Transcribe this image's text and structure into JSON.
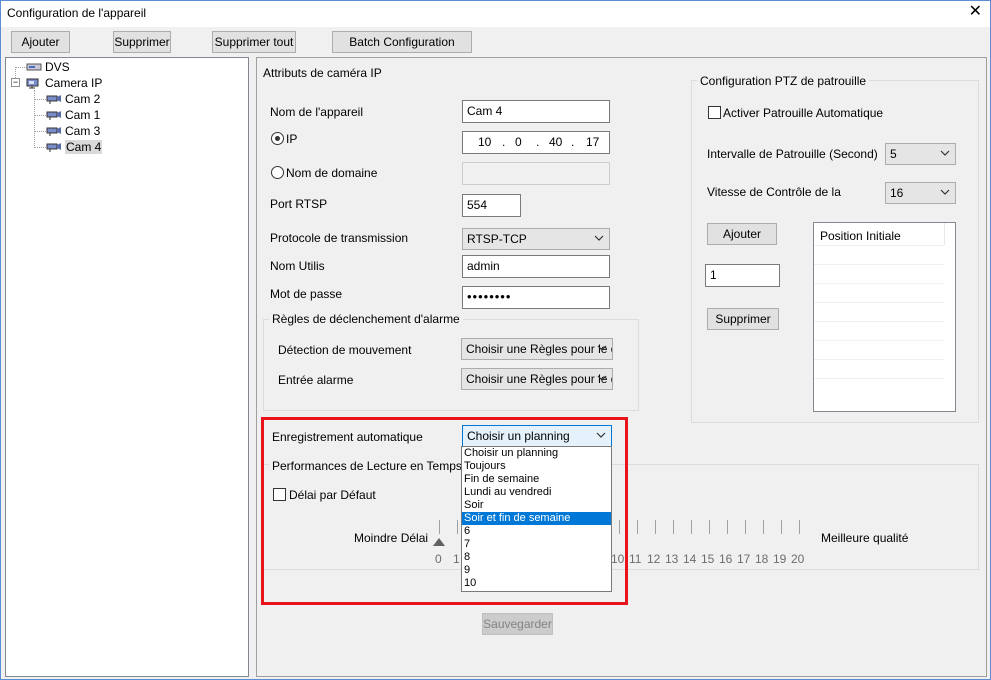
{
  "window": {
    "title": "Configuration de l'appareil",
    "close_glyph": "✕"
  },
  "toolbar": {
    "add": "Ajouter",
    "delete": "Supprimer",
    "delete_all": "Supprimer tout",
    "batch": "Batch Configuration"
  },
  "tree": {
    "dvs": "DVS",
    "camera_ip": "Camera IP",
    "cams": [
      "Cam 2",
      "Cam 1",
      "Cam 3",
      "Cam 4"
    ],
    "selected": "Cam 4"
  },
  "attrs": {
    "section_title": "Attributs de caméra IP",
    "device_name_label": "Nom de l'appareil",
    "device_name_value": "Cam 4",
    "ip_label": "IP",
    "ip": [
      "10",
      "0",
      "40",
      "17"
    ],
    "ip_sep": ".",
    "domain_label": "Nom de domaine",
    "domain_value": "",
    "rtsp_port_label": "Port RTSP",
    "rtsp_port_value": "554",
    "protocol_label": "Protocole de transmission",
    "protocol_value": "RTSP-TCP",
    "user_label": "Nom Utilis",
    "user_value": "admin",
    "password_label": "Mot de passe",
    "password_value": "••••••••"
  },
  "alarm": {
    "group_title": "Règles de déclenchement d'alarme",
    "motion_label": "Détection de mouvement",
    "motion_value": "Choisir une Règles pour le d",
    "input_label": "Entrée alarme",
    "input_value": "Choisir une Règles pour le d"
  },
  "recording": {
    "label": "Enregistrement automatique",
    "value": "Choisir un planning",
    "options": [
      "Choisir un planning",
      "Toujours",
      "Fin de semaine",
      "Lundi au vendredi",
      "Soir",
      "Soir et fin de semaine",
      "6",
      "7",
      "8",
      "9",
      "10"
    ],
    "highlighted_option": "Soir et fin de semaine"
  },
  "playback": {
    "label": "Performances de Lecture en Temps Rée",
    "default_delay_label": "Délai par Défaut",
    "min_delay_label": "Moindre Délai",
    "best_quality_label": "Meilleure qualité",
    "visible_ticks_left": [
      "0",
      "1"
    ],
    "visible_ticks_right": [
      "10",
      "11",
      "12",
      "13",
      "14",
      "15",
      "16",
      "17",
      "18",
      "19",
      "20"
    ],
    "slider_value": 0
  },
  "save_button": "Sauvegarder",
  "ptz": {
    "group_title": "Configuration PTZ de patrouille",
    "auto_patrol_label": "Activer Patrouille Automatique",
    "interval_label": "Intervalle de Patrouille (Second)",
    "interval_value": "5",
    "speed_label": "Vitesse de Contrôle de la",
    "speed_value": "16",
    "add_button": "Ajouter",
    "preset_input": "1",
    "delete_button": "Supprimer",
    "list_header": "Position Initiale"
  },
  "colors": {
    "highlight_border": "#e8141c",
    "selection": "#0078d7"
  }
}
